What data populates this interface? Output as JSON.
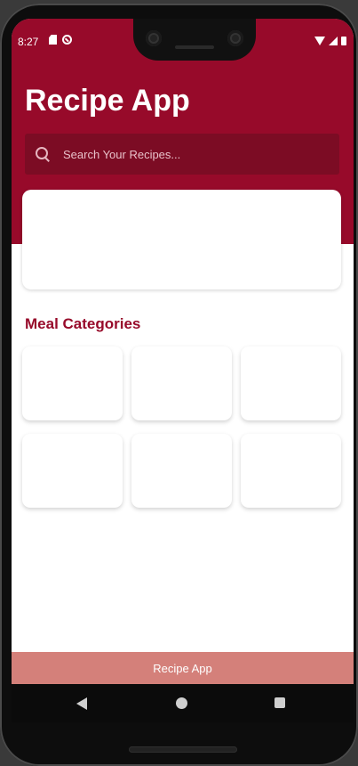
{
  "status_bar": {
    "time": "8:27",
    "left_icons": [
      "sim-card-icon",
      "do-not-disturb-icon"
    ],
    "right_icons": [
      "wifi-icon",
      "signal-icon",
      "battery-icon"
    ]
  },
  "header": {
    "title": "Recipe App",
    "background_color": "#970a2a"
  },
  "search": {
    "placeholder": "Search Your Recipes...",
    "value": "",
    "icon": "search-icon"
  },
  "featured_card": {},
  "categories": {
    "title": "Meal Categories",
    "items": [
      {},
      {},
      {},
      {},
      {},
      {}
    ]
  },
  "footer": {
    "label": "Recipe App",
    "background_color": "#d4807a"
  },
  "nav_bar": {
    "icons": [
      "back-icon",
      "home-icon",
      "recents-icon"
    ]
  }
}
